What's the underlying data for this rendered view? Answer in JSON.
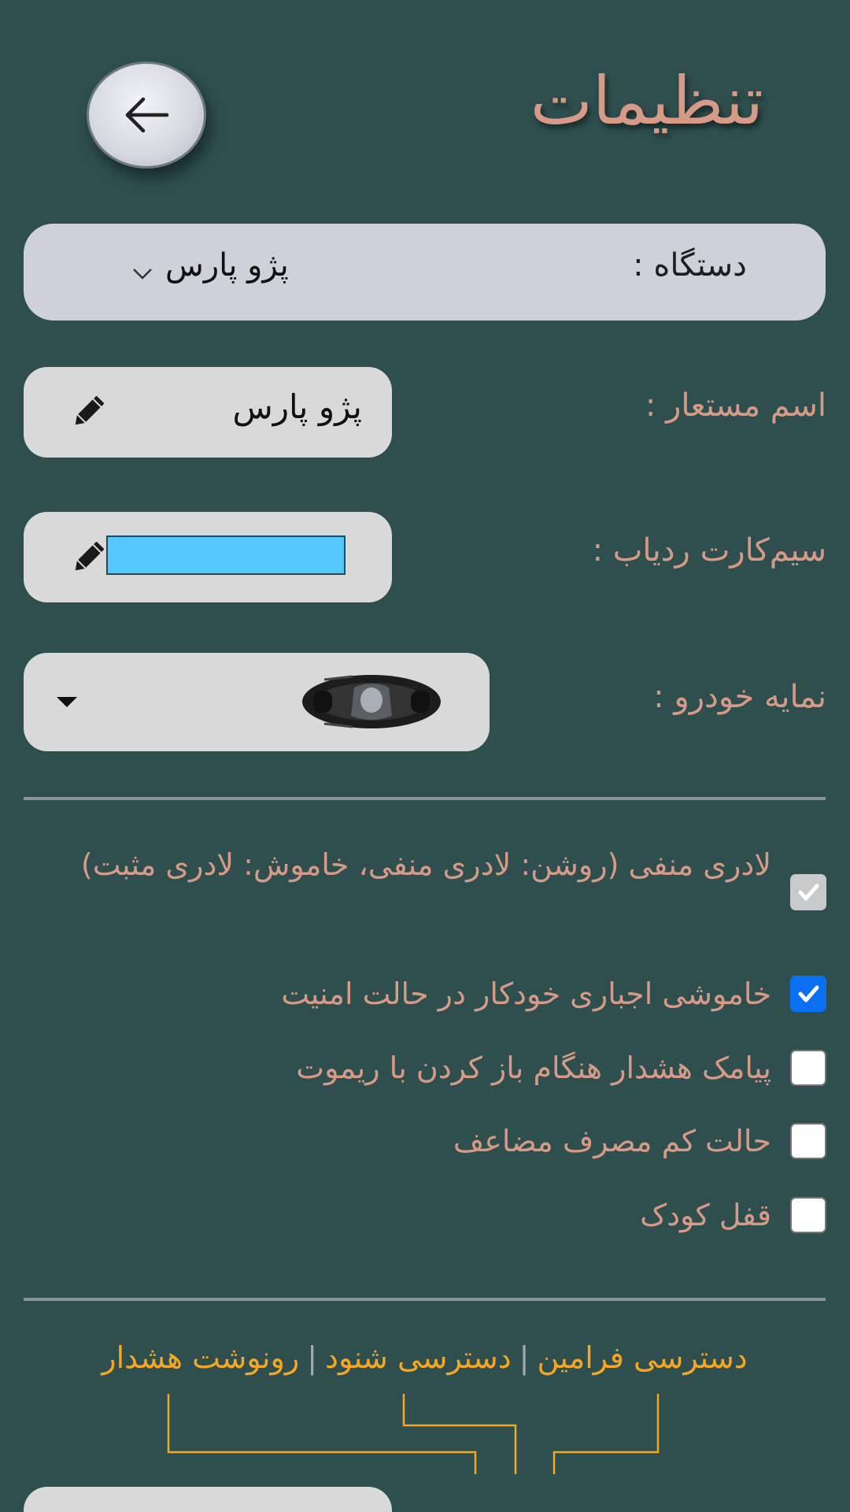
{
  "header": {
    "title": "تنظیمات"
  },
  "device": {
    "label": "دستگاه :",
    "value": "پژو پارس"
  },
  "alias": {
    "label": "اسم مستعار :",
    "value": "پژو پارس"
  },
  "sim": {
    "label": "سیم‌کارت ردیاب :",
    "value": ""
  },
  "car_icon": {
    "label": "نمایه خودرو :"
  },
  "options": [
    {
      "label": "لادری منفی (روشن: لادری منفی، خاموش: لادری مثبت)",
      "checked": true,
      "disabled": true
    },
    {
      "label": "خاموشی اجباری خودکار در حالت امنیت",
      "checked": true,
      "disabled": false
    },
    {
      "label": "پیامک هشدار هنگام باز کردن با ریموت",
      "checked": false,
      "disabled": false
    },
    {
      "label": "حالت کم مصرف مضاعف",
      "checked": false,
      "disabled": false
    },
    {
      "label": "قفل کودک",
      "checked": false,
      "disabled": false
    }
  ],
  "links": {
    "commands_access": "دسترسی فرامین",
    "listen_access": "دسترسی شنود",
    "alarm_copy": "رونوشت هشدار",
    "separator": "|"
  },
  "colors": {
    "background": "#2f4f4f",
    "label_text": "#d69a87",
    "link_text": "#f5a623",
    "checkbox_checked": "#0b6ff4",
    "sim_field": "#54c8fb"
  }
}
